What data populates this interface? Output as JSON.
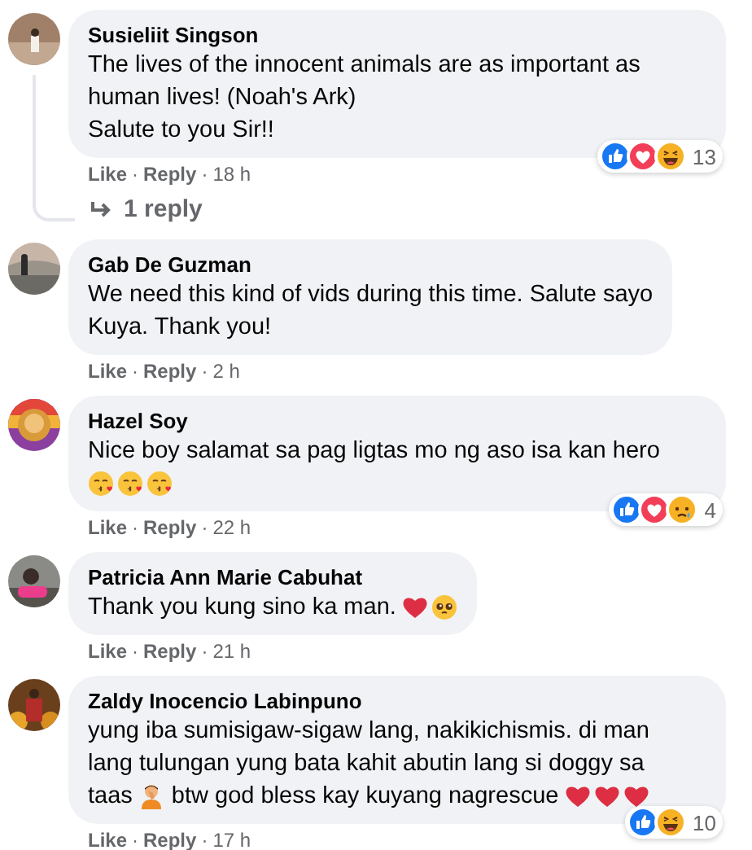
{
  "comments": [
    {
      "name": "Susieliit Singson",
      "lines": [
        [
          {
            "kind": "text",
            "text": "The lives of the innocent animals are as important as"
          }
        ],
        [
          {
            "kind": "text",
            "text": "human lives! (Noah's Ark)"
          }
        ],
        [
          {
            "kind": "text",
            "text": "Salute to you Sir!!"
          }
        ]
      ],
      "like": "Like",
      "separator": "·",
      "reply": "Reply",
      "time": "18 h",
      "reactions": {
        "icons": [
          {
            "kind": "like"
          },
          {
            "kind": "love"
          },
          {
            "kind": "haha"
          }
        ],
        "count": "13"
      },
      "replies": "1 reply"
    },
    {
      "name": "Gab De Guzman",
      "lines": [
        [
          {
            "kind": "text",
            "text": "We need this kind of vids during this time. Salute sayo"
          }
        ],
        [
          {
            "kind": "text",
            "text": "Kuya. Thank you!"
          }
        ]
      ],
      "like": "Like",
      "separator": "·",
      "reply": "Reply",
      "time": "2 h"
    },
    {
      "name": "Hazel Soy",
      "lines": [
        [
          {
            "kind": "text",
            "text": "Nice boy salamat sa pag ligtas mo ng aso isa kan hero"
          }
        ],
        [
          {
            "kind": "kiss"
          },
          {
            "kind": "kiss"
          },
          {
            "kind": "kiss"
          }
        ]
      ],
      "like": "Like",
      "separator": "·",
      "reply": "Reply",
      "time": "22 h",
      "reactions": {
        "icons": [
          {
            "kind": "like"
          },
          {
            "kind": "love"
          },
          {
            "kind": "sad"
          }
        ],
        "count": "4"
      }
    },
    {
      "name": "Patricia Ann Marie Cabuhat",
      "lines": [
        [
          {
            "kind": "text",
            "text": "Thank you kung sino ka man."
          },
          {
            "kind": "heart"
          },
          {
            "kind": "pleading"
          }
        ]
      ],
      "like": "Like",
      "separator": "·",
      "reply": "Reply",
      "time": "21 h"
    },
    {
      "name": "Zaldy Inocencio Labinpuno",
      "lines": [
        [
          {
            "kind": "text",
            "text": "yung iba sumisigaw-sigaw lang, nakikichismis. di man"
          }
        ],
        [
          {
            "kind": "text",
            "text": "lang tulungan yung bata kahit abutin lang si doggy sa"
          }
        ],
        [
          {
            "kind": "text",
            "text": "taas"
          },
          {
            "kind": "facepalm"
          },
          {
            "kind": "text",
            "text": "btw god bless kay kuyang nagrescue"
          },
          {
            "kind": "heart"
          },
          {
            "kind": "heart"
          },
          {
            "kind": "heart"
          }
        ]
      ],
      "like": "Like",
      "separator": "·",
      "reply": "Reply",
      "time": "17 h",
      "reactions": {
        "icons": [
          {
            "kind": "like"
          },
          {
            "kind": "haha"
          }
        ],
        "count": "10"
      }
    }
  ]
}
